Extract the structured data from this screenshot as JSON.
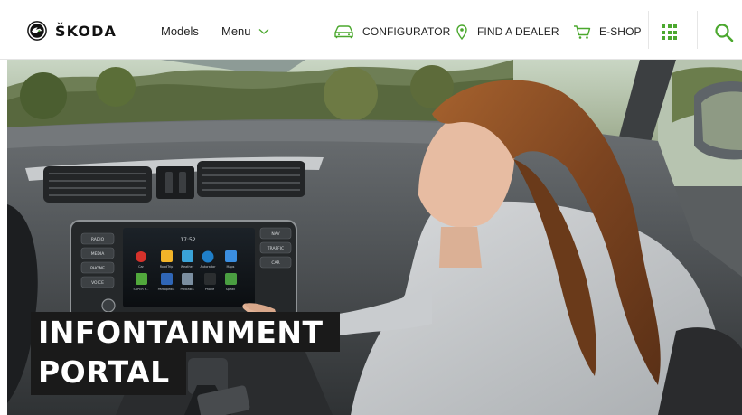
{
  "brand": {
    "name": "ŠKODA"
  },
  "nav": {
    "models_label": "Models",
    "menu_label": "Menu"
  },
  "utility": {
    "configurator_label": "CONFIGURATOR",
    "dealer_label": "FIND A DEALER",
    "eshop_label": "E-SHOP"
  },
  "hero": {
    "title_line1": "INFONTAINMENT",
    "title_line2": "PORTAL"
  },
  "infotainment_screen": {
    "time": "17:52",
    "buttons_left": [
      "RADIO",
      "MEDIA",
      "PHONE",
      "VOICE"
    ],
    "buttons_right": [
      "NAV",
      "TRAFFIC",
      "CAR"
    ],
    "apps_row1": [
      "Car",
      "RoadTrip",
      "Weather",
      "Autoradar",
      "Maps"
    ],
    "apps_row2": [
      "SUPER F...",
      "Parkopedia",
      "Podcasts",
      "Phone",
      "Speak"
    ]
  },
  "colors": {
    "brand_green": "#4ba82e",
    "title_bg": "#1a1a1a",
    "header_bg": "#ffffff"
  },
  "icons": [
    "skoda-logo-icon",
    "chevron-down-icon",
    "car-icon",
    "location-pin-icon",
    "cart-icon",
    "app-grid-icon",
    "search-icon"
  ]
}
